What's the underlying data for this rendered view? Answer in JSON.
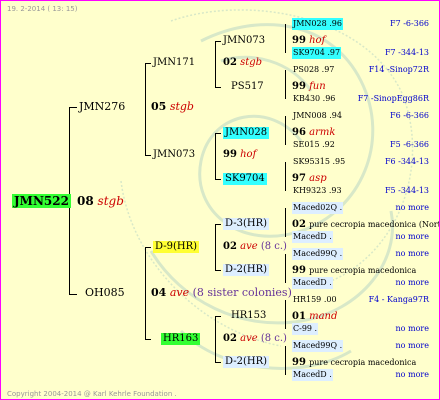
{
  "header": {
    "date": "19.  2-2014 ( 13: 15)"
  },
  "footer": {
    "copyright": "Copyright 2004-2014 @ Karl Kehrle Foundation ."
  },
  "root": {
    "id": "JMN522",
    "num": "08",
    "tag": "stgb"
  },
  "sire": {
    "id": "JMN276"
  },
  "dam": {
    "id": "OH085"
  },
  "s_num": "05",
  "s_tag": "stgb",
  "d_num": "04",
  "d_tag": "ave",
  "d_note": "(8 sister colonies)",
  "ss": {
    "id": "JMN171"
  },
  "sd": {
    "id": "JMN073"
  },
  "ds": {
    "id": "D-9(HR)"
  },
  "dd": {
    "id": "HR163"
  },
  "ss_num": "02",
  "ss_tag": "stgb",
  "sd_num": "99",
  "sd_tag": "hof",
  "ds_num": "02",
  "ds_tag": "ave",
  "ds_note": "(8 c.)",
  "dd_num": "02",
  "dd_tag": "ave",
  "dd_note": "(8 c.)",
  "g3": {
    "a1": "JMN073",
    "a2": "PS517",
    "b1": "JMN028",
    "b2": "SK9704",
    "c1": "D-3(HR)",
    "c2": "D-2(HR)",
    "d1": "HR153",
    "d2": "D-2(HR)"
  },
  "g4": [
    {
      "id": "JMN028 .96",
      "info": "F7 -6-366"
    },
    {
      "num": "99",
      "tag": "hof"
    },
    {
      "id": "SK9704 .97",
      "info": "F7 -344-13"
    },
    {
      "id": "PS028 .97",
      "info": "F14 -Sinop72R"
    },
    {
      "num": "99",
      "tag": "fun"
    },
    {
      "id": "KB430 .96",
      "info": "F7 -SinopEgg86R"
    },
    {
      "id": "JMN008 .94",
      "info": "F6 -6-366"
    },
    {
      "num": "96",
      "tag": "armk"
    },
    {
      "id": "SE015 .92",
      "info": "F5 -6-366"
    },
    {
      "id": "SK95315 .95",
      "info": "F6 -344-13"
    },
    {
      "num": "97",
      "tag": "asp"
    },
    {
      "id": "KH9323 .93",
      "info": "F5 -344-13"
    },
    {
      "id": "Maced02Q .",
      "info": "no more"
    },
    {
      "num": "02",
      "tag": "pure cecropia macedonica (North-Ma"
    },
    {
      "id": "MacedD .",
      "info": "no more"
    },
    {
      "id": "Maced99Q .",
      "info": "no more"
    },
    {
      "num": "99",
      "tag": "pure cecropia macedonica"
    },
    {
      "id": "MacedD .",
      "info": "no more"
    },
    {
      "id": "HR159 .00",
      "info": "F4 - Kanga97R"
    },
    {
      "num": "01",
      "tag": "mand"
    },
    {
      "id": "C-99 .",
      "info": "no more"
    },
    {
      "id": "Maced99Q .",
      "info": "no more"
    },
    {
      "num": "99",
      "tag": "pure cecropia macedonica"
    },
    {
      "id": "MacedD .",
      "info": "no more"
    }
  ]
}
